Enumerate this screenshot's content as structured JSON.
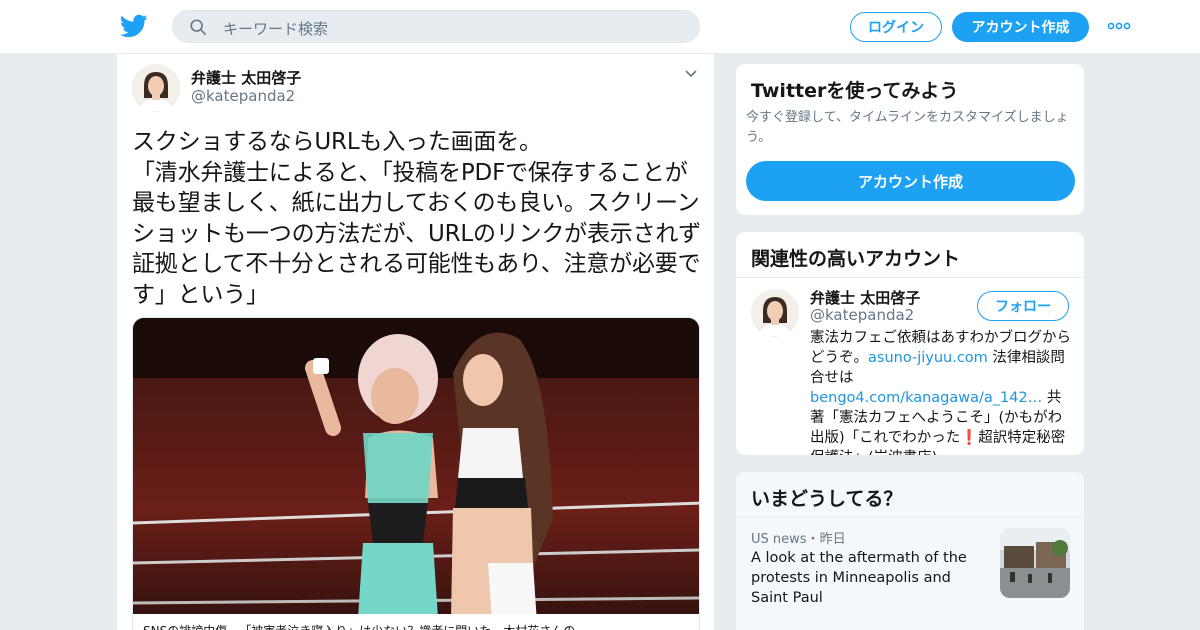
{
  "nav": {
    "search_placeholder": "キーワード検索",
    "login_label": "ログイン",
    "signup_label": "アカウント作成",
    "brand_color": "#1da1f2"
  },
  "tweet": {
    "author_name": "弁護士 太田啓子",
    "author_handle": "@katepanda2",
    "text": "スクショするならURLも入った画面を。\n「清水弁護士によると、「投稿をPDFで保存することが最も望ましく、紙に出力しておくのも良い。スクリーンショットも一つの方法だが、URLのリンクが表示されず証拠として不十分とされる可能性もあり、注意が必要です」という」",
    "media_caption": "SNSの誹謗中傷…「被害者泣き寝入り」は少ない？識者に聞いた　木村花さんの"
  },
  "sidebar": {
    "try": {
      "title": "Twitterを使ってみよう",
      "subtitle": "今すぐ登録して、タイムラインをカスタマイズしましょう。",
      "button": "アカウント作成"
    },
    "related": {
      "title": "関連性の高いアカウント",
      "name": "弁護士 太田啓子",
      "handle": "@katepanda2",
      "follow": "フォロー",
      "bio_1": "憲法カフェご依頼はあすわかブログからどうぞ。",
      "bio_link1": "asuno-jiyuu.com",
      "bio_2": " 法律相談問合せは",
      "bio_link2": "bengo4.com/kanagawa/a_142…",
      "bio_3": " 共著「憲法カフェへようこそ」(かもがわ出版)「これでわかった",
      "bio_mark": "❗",
      "bio_4": "超訳特定秘密保護法」(岩波書店)。"
    },
    "trends": {
      "title": "いまどうしてる？",
      "source": "US news",
      "dot": "・",
      "time": "昨日",
      "headline": "A look at the aftermath of the protests in Minneapolis and Saint Paul"
    }
  }
}
